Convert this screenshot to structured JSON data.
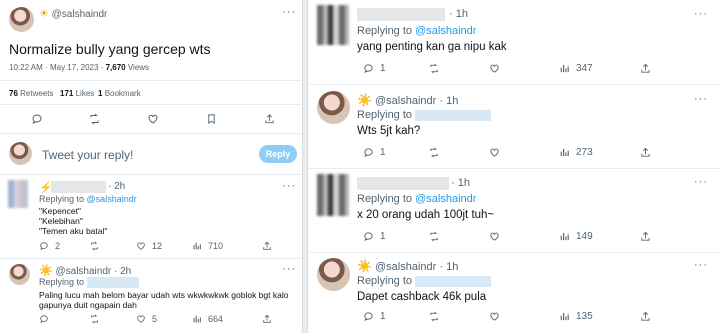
{
  "main_tweet": {
    "handle": "@salshaindr",
    "text": "Normalize bully yang gercep wts",
    "time": "10:22 AM",
    "date": "May 17, 2023",
    "views": "7,670",
    "views_label": "Views",
    "retweets": "76",
    "retweets_label": "Retweets",
    "likes": "171",
    "likes_label": "Likes",
    "bookmarks": "1",
    "bookmarks_label": "Bookmark"
  },
  "reply_box": {
    "placeholder": "Tweet your reply!",
    "button": "Reply"
  },
  "left_replies": [
    {
      "emoji": "⚡",
      "time": "2h",
      "replying_label": "Replying to",
      "replying_to": "@salshaindr",
      "lines": [
        "\"Kepencet\"",
        "\"Kelebihan\"",
        "\"Temen aku batal\""
      ],
      "stats": {
        "replies": "2",
        "likes": "12",
        "views": "710"
      }
    },
    {
      "emoji": "☀️",
      "handle": "@salshaindr",
      "time": "2h",
      "replying_label": "Replying to",
      "lines": [
        "Paling lucu mah belom bayar udah wts wkwkwkwk goblok bgt kalo",
        "gapunya duit ngapain dah"
      ],
      "stats": {
        "replies": "",
        "likes": "5",
        "views": "664"
      }
    }
  ],
  "right_replies": [
    {
      "time": "1h",
      "replying_label": "Replying to",
      "replying_to": "@salshaindr",
      "text": "yang penting kan ga nipu kak",
      "stats": {
        "replies": "1",
        "likes": "",
        "views": "347"
      }
    },
    {
      "emoji": "☀️",
      "handle": "@salshaindr",
      "time": "1h",
      "replying_label": "Replying to",
      "text": "Wts 5jt kah?",
      "stats": {
        "replies": "1",
        "likes": "",
        "views": "273"
      }
    },
    {
      "time": "1h",
      "replying_label": "Replying to",
      "replying_to": "@salshaindr",
      "text": "x 20 orang udah 100jt tuh~",
      "stats": {
        "replies": "1",
        "likes": "",
        "views": "149"
      }
    },
    {
      "emoji": "☀️",
      "handle": "@salshaindr",
      "time": "1h",
      "replying_label": "Replying to",
      "text": "Dapet cashback 46k pula",
      "stats": {
        "replies": "1",
        "likes": "",
        "views": "135"
      }
    }
  ],
  "ui": {
    "more": "···",
    "dot": "·"
  },
  "colors": {
    "link": "#1d9bf0",
    "muted": "#536471",
    "reply_button": "#8ecdf8"
  }
}
